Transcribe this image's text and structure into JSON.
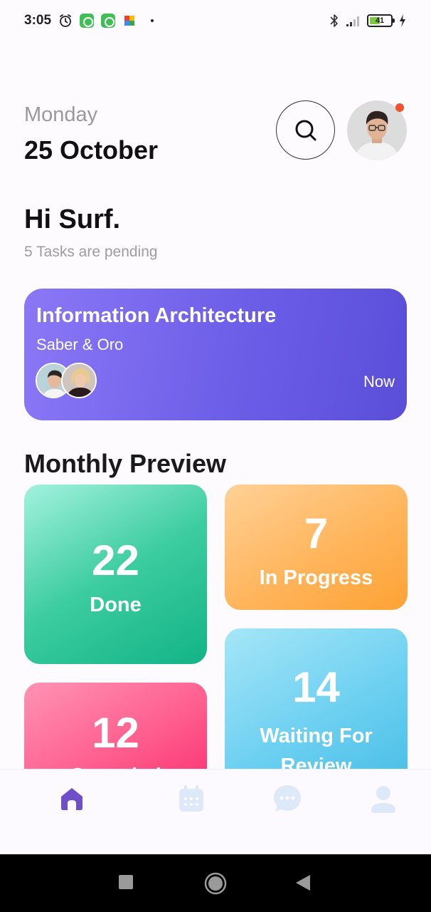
{
  "status_bar": {
    "time": "3:05",
    "battery_level": "41"
  },
  "header": {
    "day": "Monday",
    "date": "25 October"
  },
  "greeting": {
    "title": "Hi Surf.",
    "subtitle": "5 Tasks are pending"
  },
  "task_card": {
    "title": "Information Architecture",
    "members": "Saber & Oro",
    "time": "Now"
  },
  "monthly_preview": {
    "title": "Monthly Preview",
    "stats": [
      {
        "value": "22",
        "label": "Done"
      },
      {
        "value": "7",
        "label": "In Progress"
      },
      {
        "value": "14",
        "label": "Waiting For Review"
      },
      {
        "value": "12",
        "label": "Canceled"
      }
    ]
  },
  "nav": {
    "items": [
      "home-icon",
      "calendar-icon",
      "chat-icon",
      "profile-icon"
    ],
    "active_color": "#6f4fc8",
    "inactive_color": "#dde8f8"
  },
  "colors": {
    "accent": "#6d5ee8",
    "notification": "#f0512e"
  }
}
